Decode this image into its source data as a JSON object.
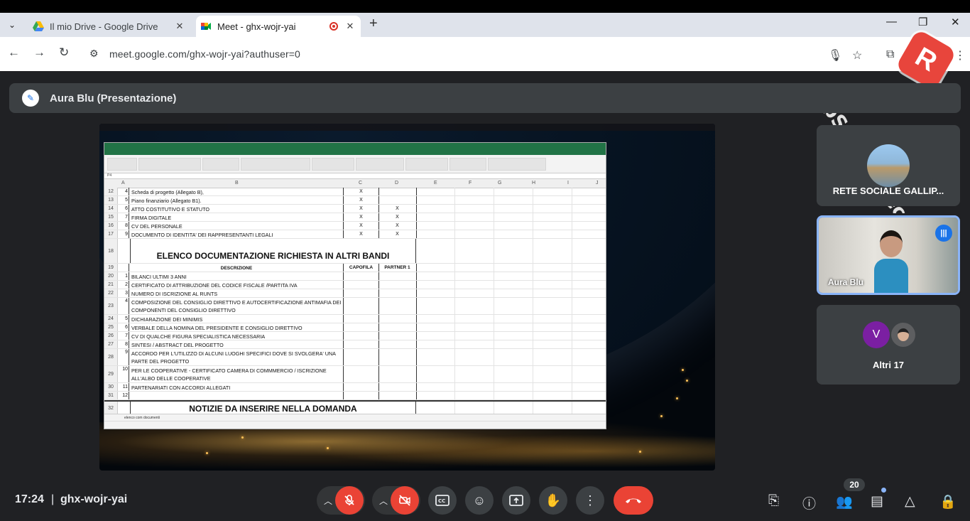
{
  "browser": {
    "tabs": [
      {
        "title": "Il mio Drive - Google Drive",
        "close": "✕"
      },
      {
        "title": "Meet - ghx-wojr-yai",
        "close": "✕"
      }
    ],
    "new_tab": "+",
    "url": "meet.google.com/ghx-wojr-yai?authuser=0"
  },
  "watermark": {
    "text": "iTopScreen Recorder"
  },
  "presenter": {
    "label": "Aura Blu (Presentazione)"
  },
  "spreadsheet": {
    "columns": [
      "A",
      "B",
      "C",
      "D",
      "E",
      "F",
      "G",
      "H",
      "I",
      "J"
    ],
    "name_box": "P4",
    "sheet_tab": "elenco com documenti",
    "rows": [
      {
        "num": "12",
        "a": "4",
        "b": "Scheda di progetto (Allegato B),",
        "c": "X",
        "d": ""
      },
      {
        "num": "13",
        "a": "5",
        "b": "Piano finanziario (Allegato B1).",
        "c": "X",
        "d": ""
      },
      {
        "num": "14",
        "a": "6",
        "b": "ATTO COSTITUTIVO E STATUTO",
        "c": "X",
        "d": "X"
      },
      {
        "num": "15",
        "a": "7",
        "b": "FIRMA DIGITALE",
        "c": "X",
        "d": "X"
      },
      {
        "num": "16",
        "a": "8",
        "b": "CV DEL PERSONALE",
        "c": "X",
        "d": "X"
      },
      {
        "num": "17",
        "a": "9",
        "b": "DOCUMENTO DI IDENTITA' DEI RAPPRESENTANTI LEGALI",
        "c": "X",
        "d": "X"
      }
    ],
    "section_title": "ELENCO DOCUMENTAZIONE RICHIESTA IN ALTRI BANDI",
    "header_row": {
      "num": "19",
      "description": "DESCRIZIONE",
      "capofila": "CAPOFILA",
      "partner": "PARTNER 1"
    },
    "rows2": [
      {
        "num": "20",
        "a": "1",
        "b": "BILANCI ULTIMI 3 ANNI"
      },
      {
        "num": "21",
        "a": "2",
        "b": "CERTIFICATO DI ATTRIBUZIONE DEL CODICE FISCALE /PARTITA IVA"
      },
      {
        "num": "22",
        "a": "3",
        "b": "NUMERO DI ISCRIZIONE AL RUNTS"
      },
      {
        "num": "23",
        "a": "4",
        "b": "COMPOSIZIONE DEL CONSIGLIO DIRETTIVO E AUTOCERTIFICAZIONE ANTIMAFIA DEI COMPONENTI DEL CONSIGLIO DIRETTIVO"
      },
      {
        "num": "24",
        "a": "5",
        "b": "DICHIARAZIONE DEI MINIMIS"
      },
      {
        "num": "25",
        "a": "6",
        "b": "VERBALE DELLA NOMINA DEL PRESIDENTE E CONSIGLIO DIRETTIVO"
      },
      {
        "num": "26",
        "a": "7",
        "b": "CV DI QUALCHE FIGURA SPECIALISTICA NECESSARIA"
      },
      {
        "num": "27",
        "a": "8",
        "b": "SINTESI / ABSTRACT DEL PROGETTO"
      },
      {
        "num": "28",
        "a": "9",
        "b": "ACCORDO PER L'UTILIZZO DI ALCUNI LUOGHI SPECIFICI DOVE SI SVOLGERA' UNA PARTE DEL PROGETTO"
      },
      {
        "num": "29",
        "a": "10",
        "b": "PER LE COOPERATIVE - CERTIFICATO CAMERA DI COMMMERCIO / ISCRIZIONE ALL'ALBO DELLE COOPERATIVE"
      },
      {
        "num": "30",
        "a": "11",
        "b": "PARTENARIATI CON ACCORDI ALLEGATI"
      },
      {
        "num": "31",
        "a": "12",
        "b": ""
      }
    ],
    "section_title2": "NOTIZIE DA INSERIRE NELLA DOMANDA",
    "section_title2_row": "32",
    "section_title_row": "18"
  },
  "participants": [
    {
      "name": "RETE SOCIALE GALLIP..."
    },
    {
      "name": "Aura Blu"
    },
    {
      "name": "Altri 17",
      "initial": "V"
    }
  ],
  "bottom": {
    "time": "17:24",
    "separator": "|",
    "meeting_code": "ghx-wojr-yai",
    "participant_count": "20"
  },
  "icons": {
    "mic": "mic-off-icon",
    "camera": "videocam-off-icon",
    "captions": "closed-caption-icon",
    "emoji": "emoji-icon",
    "present": "present-screen-icon",
    "hand": "raise-hand-icon",
    "more": "more-vert-icon",
    "end": "call-end-icon"
  },
  "colors": {
    "end_call": "#ea4335",
    "excel_green": "#217346",
    "accent": "#8ab4f8"
  }
}
